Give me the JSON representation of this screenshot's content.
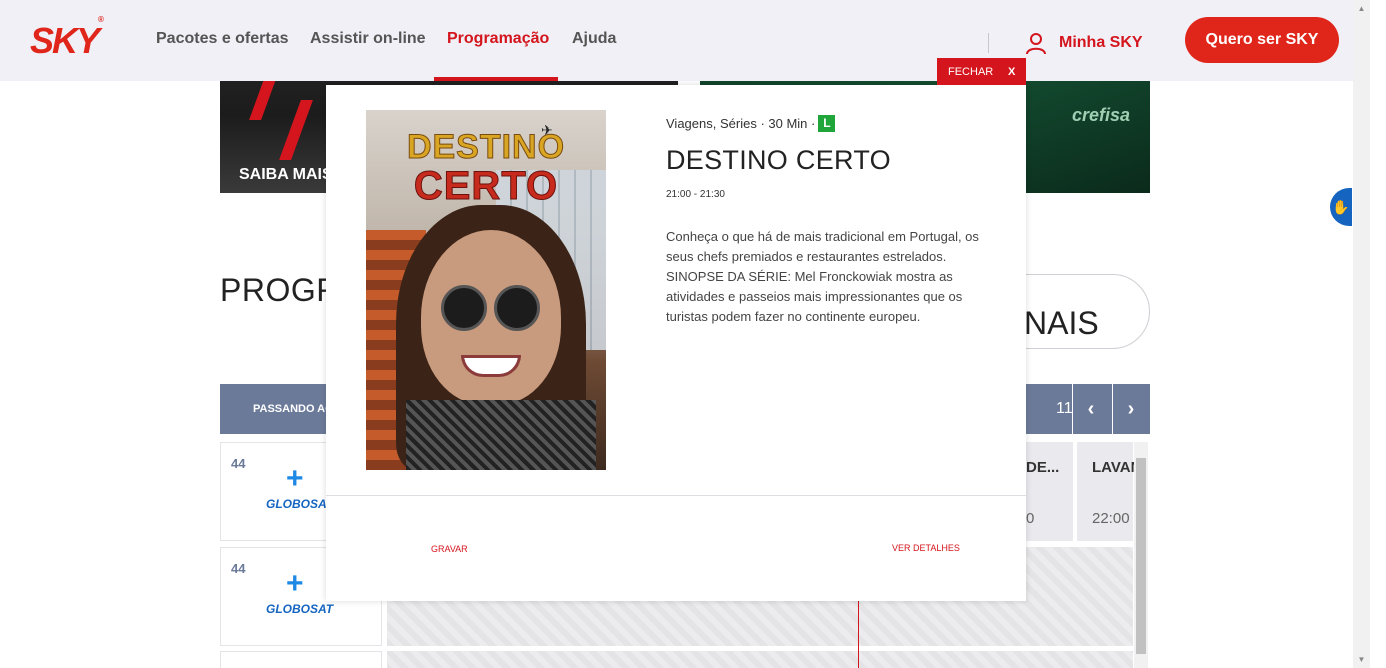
{
  "header": {
    "logo": "SKY",
    "nav": [
      "Pacotes e ofertas",
      "Assistir on-line",
      "Programação",
      "Ajuda"
    ],
    "active_nav": "Programação",
    "account_label": "Minha SKY",
    "cta_label": "Quero ser SKY"
  },
  "background": {
    "banner_left_text": "SAIBA MAIS",
    "banner_right_text": "crefisa",
    "section_title": "PROGR",
    "pill_text": "NAIS",
    "guide_bar_label": "PASSANDO AG",
    "page_number": "11",
    "rows": [
      {
        "channel_number": "44",
        "channel_logo": "GLOBOSAT",
        "cells": [
          {
            "name": "DE...",
            "time": "0"
          },
          {
            "name": "LAVAN",
            "time": "22:00"
          }
        ]
      },
      {
        "channel_number": "44",
        "channel_logo": "GLOBOSAT"
      }
    ]
  },
  "modal": {
    "close_label": "FECHAR",
    "close_x": "X",
    "poster_title_line1": "DESTINO",
    "poster_title_line2": "CERTO",
    "meta_genre": "Viagens, Séries",
    "meta_duration": "30 Min",
    "rating": "L",
    "title": "DESTINO CERTO",
    "time_range": "21:00 - 21:30",
    "description": [
      "Conheça o que há de mais tradicional em Portugal, os",
      "seus chefs premiados e restaurantes estrelados.",
      "SINOPSE DA SÉRIE: Mel Fronckowiak mostra as",
      "atividades e passeios mais impressionantes que os",
      "turistas podem fazer no continente europeu."
    ],
    "record_label": "GRAVAR",
    "details_label": "VER DETALHES"
  },
  "colors": {
    "brand_red": "#d5151d",
    "header_bg": "#f0f0f6",
    "guide_bar": "#6b7a99",
    "rating_green": "#1fa539"
  }
}
